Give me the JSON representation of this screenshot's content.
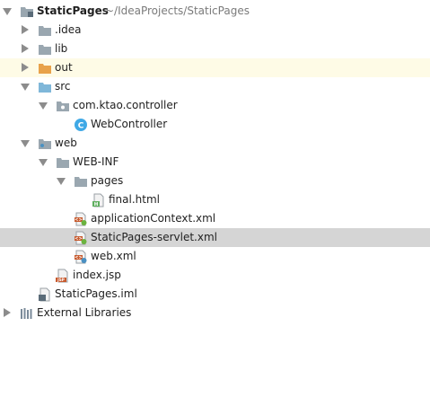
{
  "project": {
    "name": "StaticPages",
    "path": "~/IdeaProjects/StaticPages"
  },
  "tree": {
    "idea": ".idea",
    "lib": "lib",
    "out": "out",
    "src": "src",
    "package": "com.ktao.controller",
    "web_controller": "WebController",
    "web": "web",
    "web_inf": "WEB-INF",
    "pages": "pages",
    "final_html": "final.html",
    "app_context": "applicationContext.xml",
    "servlet_xml": "StaticPages-servlet.xml",
    "web_xml": "web.xml",
    "index_jsp": "index.jsp",
    "iml": "StaticPages.iml",
    "external_libraries": "External Libraries"
  },
  "icons": {
    "class_badge": "C",
    "html_badge": "H",
    "xml_badge": "<>",
    "jsp_badge": "JSP"
  },
  "colors": {
    "folder_gray": "#9aa7b0",
    "folder_orange": "#e8a24a",
    "folder_blue": "#7fb7d9",
    "class_blue": "#40a9e6",
    "selected_row": "#d5d5d5",
    "hover_row": "#fefbe6"
  }
}
